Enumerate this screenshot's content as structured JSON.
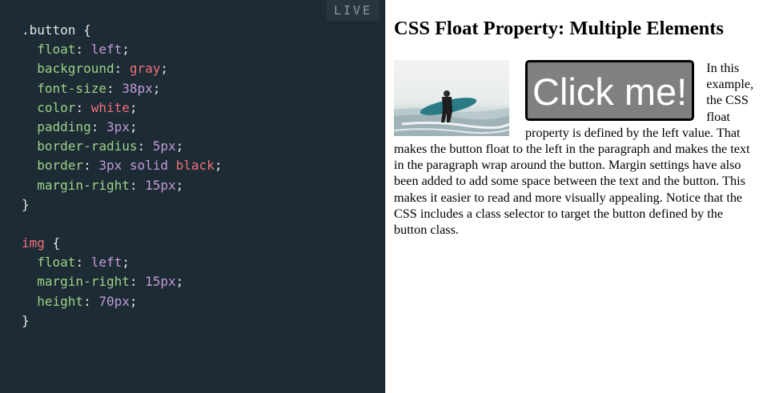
{
  "editor": {
    "live_label": "LIVE",
    "lines": [
      [
        [
          "sel",
          ".button"
        ],
        [
          "punc",
          " {"
        ]
      ],
      [
        [
          "punc",
          "  "
        ],
        [
          "prop",
          "float"
        ],
        [
          "punc",
          ": "
        ],
        [
          "val",
          "left"
        ],
        [
          "punc",
          ";"
        ]
      ],
      [
        [
          "punc",
          "  "
        ],
        [
          "prop",
          "background"
        ],
        [
          "punc",
          ": "
        ],
        [
          "kw",
          "gray"
        ],
        [
          "punc",
          ";"
        ]
      ],
      [
        [
          "punc",
          "  "
        ],
        [
          "prop",
          "font-size"
        ],
        [
          "punc",
          ": "
        ],
        [
          "val",
          "38px"
        ],
        [
          "punc",
          ";"
        ]
      ],
      [
        [
          "punc",
          "  "
        ],
        [
          "prop",
          "color"
        ],
        [
          "punc",
          ": "
        ],
        [
          "kw",
          "white"
        ],
        [
          "punc",
          ";"
        ]
      ],
      [
        [
          "punc",
          "  "
        ],
        [
          "prop",
          "padding"
        ],
        [
          "punc",
          ": "
        ],
        [
          "val",
          "3px"
        ],
        [
          "punc",
          ";"
        ]
      ],
      [
        [
          "punc",
          "  "
        ],
        [
          "prop",
          "border-radius"
        ],
        [
          "punc",
          ": "
        ],
        [
          "val",
          "5px"
        ],
        [
          "punc",
          ";"
        ]
      ],
      [
        [
          "punc",
          "  "
        ],
        [
          "prop",
          "border"
        ],
        [
          "punc",
          ": "
        ],
        [
          "val",
          "3px solid "
        ],
        [
          "kw",
          "black"
        ],
        [
          "punc",
          ";"
        ]
      ],
      [
        [
          "punc",
          "  "
        ],
        [
          "prop",
          "margin-right"
        ],
        [
          "punc",
          ": "
        ],
        [
          "val",
          "15px"
        ],
        [
          "punc",
          ";"
        ]
      ],
      [
        [
          "punc",
          "}"
        ]
      ],
      [],
      [
        [
          "tag",
          "img"
        ],
        [
          "punc",
          " {"
        ]
      ],
      [
        [
          "punc",
          "  "
        ],
        [
          "prop",
          "float"
        ],
        [
          "punc",
          ": "
        ],
        [
          "val",
          "left"
        ],
        [
          "punc",
          ";"
        ]
      ],
      [
        [
          "punc",
          "  "
        ],
        [
          "prop",
          "margin-right"
        ],
        [
          "punc",
          ": "
        ],
        [
          "val",
          "15px"
        ],
        [
          "punc",
          ";"
        ]
      ],
      [
        [
          "punc",
          "  "
        ],
        [
          "prop",
          "height"
        ],
        [
          "punc",
          ": "
        ],
        [
          "val",
          "70px"
        ],
        [
          "punc",
          ";"
        ]
      ],
      [
        [
          "punc",
          "}"
        ]
      ]
    ]
  },
  "preview": {
    "heading": "CSS Float Property: Multiple Elements",
    "button_label": "Click me!",
    "image_description_icon": "surfer-photo",
    "paragraph": "In this example, the CSS float property is defined by the left value. That makes the button float to the left in the paragraph and makes the text in the paragraph wrap around the button. Margin settings have also been added to add some space between the text and the button. This makes it easier to read and more visually appealing. Notice that the CSS includes a class selector to target the button defined by the button class."
  },
  "colors": {
    "editor_bg": "#1c2b34",
    "selector": "#e6e6e6",
    "tag": "#f0707a",
    "property": "#9fd08a",
    "value": "#c39ad8",
    "keyword": "#f0707a"
  }
}
